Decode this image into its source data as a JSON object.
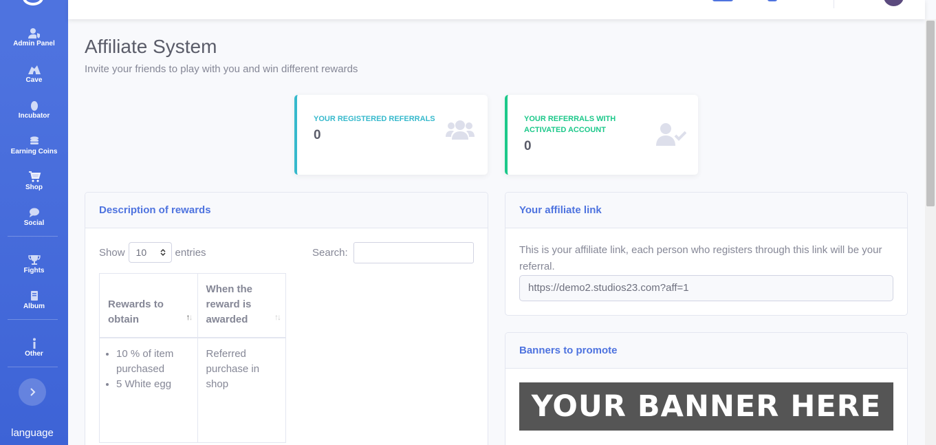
{
  "sidebar": {
    "items": [
      {
        "label": "Admin Panel",
        "icon": "user-shield-icon"
      },
      {
        "label": "Cave",
        "icon": "cave-icon"
      },
      {
        "label": "Incubator",
        "icon": "egg-icon"
      },
      {
        "label": "Earning Coins",
        "icon": "coins-icon"
      },
      {
        "label": "Shop",
        "icon": "shopping-cart-icon"
      },
      {
        "label": "Social",
        "icon": "comment-icon"
      },
      {
        "label": "Fights",
        "icon": "trophy-icon"
      },
      {
        "label": "Album",
        "icon": "book-icon"
      },
      {
        "label": "Other",
        "icon": "info-icon"
      }
    ],
    "toggle_icon": "chevron-right-icon",
    "language_label": "language"
  },
  "page": {
    "title": "Affiliate System",
    "subtitle": "Invite your friends to play with you and win different rewards"
  },
  "stats": {
    "registered": {
      "title": "Your registered referrals",
      "value": "0",
      "color": "#36b9cc",
      "icon": "users-icon"
    },
    "activated": {
      "title": "Your referrals with activated account",
      "value": "0",
      "color": "#1cc88a",
      "icon": "user-check-icon"
    }
  },
  "rewards_card": {
    "header": "Description of rewards",
    "show_label": "Show",
    "entries_value": "10",
    "entries_label": "entries",
    "search_label": "Search:",
    "columns": [
      "Rewards to obtain",
      "When the reward is awarded"
    ],
    "rows": [
      {
        "rewards": [
          "10 % of item purchased",
          "5 White egg"
        ],
        "when": "Referred purchase in shop"
      }
    ]
  },
  "affiliate_card": {
    "header": "Your affiliate link",
    "description": "This is your affiliate link, each person who registers through this link will be your referral.",
    "link": "https://demo2.studios23.com?aff=1"
  },
  "banners_card": {
    "header": "Banners to promote",
    "banner_text": "YOUR BANNER HERE"
  },
  "colors": {
    "primary": "#4e73df",
    "info": "#36b9cc",
    "success": "#1cc88a"
  }
}
